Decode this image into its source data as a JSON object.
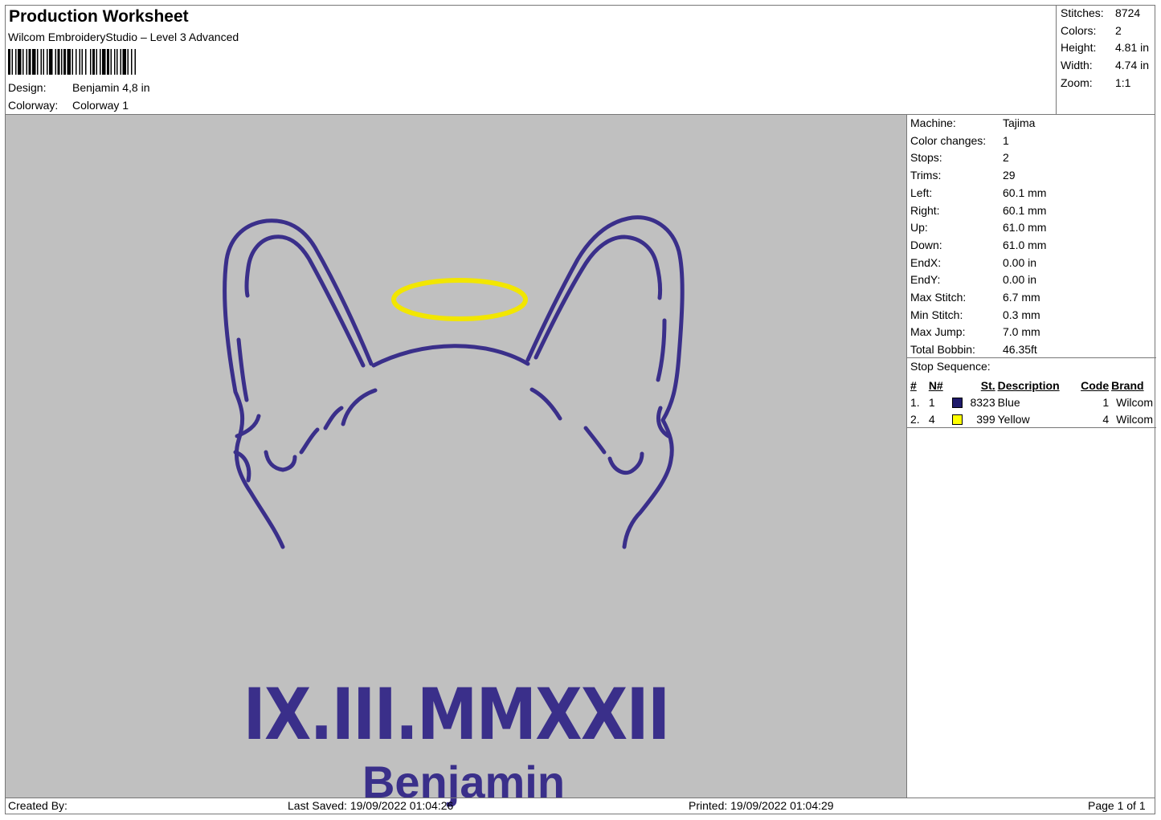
{
  "header": {
    "title": "Production Worksheet",
    "subtitle": "Wilcom EmbroideryStudio – Level 3 Advanced",
    "design_label": "Design:",
    "design_value": "Benjamin 4,8 in",
    "colorway_label": "Colorway:",
    "colorway_value": "Colorway 1"
  },
  "stats": [
    {
      "label": "Stitches:",
      "value": "8724"
    },
    {
      "label": "Colors:",
      "value": "2"
    },
    {
      "label": "Height:",
      "value": "4.81 in"
    },
    {
      "label": "Width:",
      "value": "4.74 in"
    },
    {
      "label": "Zoom:",
      "value": "1:1"
    }
  ],
  "machine_info": [
    {
      "label": "Machine:",
      "value": "Tajima"
    },
    {
      "label": "Color changes:",
      "value": "1"
    },
    {
      "label": "Stops:",
      "value": "2"
    },
    {
      "label": "Trims:",
      "value": "29"
    },
    {
      "label": "Left:",
      "value": "60.1 mm"
    },
    {
      "label": "Right:",
      "value": "60.1 mm"
    },
    {
      "label": "Up:",
      "value": "61.0 mm"
    },
    {
      "label": "Down:",
      "value": "61.0 mm"
    },
    {
      "label": "EndX:",
      "value": "0.00 in"
    },
    {
      "label": "EndY:",
      "value": "0.00 in"
    },
    {
      "label": "Max Stitch:",
      "value": "6.7 mm"
    },
    {
      "label": "Min Stitch:",
      "value": "0.3 mm"
    },
    {
      "label": "Max Jump:",
      "value": "7.0 mm"
    },
    {
      "label": "Total Bobbin:",
      "value": "46.35ft"
    }
  ],
  "stop_sequence": {
    "title": "Stop Sequence:",
    "columns": [
      "#",
      "N#",
      "St.",
      "Description",
      "Code",
      "Brand"
    ],
    "rows": [
      {
        "num": "1.",
        "n": "1",
        "color": "#1f1a6b",
        "st": "8323",
        "description": "Blue",
        "code": "1",
        "brand": "Wilcom"
      },
      {
        "num": "2.",
        "n": "4",
        "color": "#ffff00",
        "st": "399",
        "description": "Yellow",
        "code": "4",
        "brand": "Wilcom"
      }
    ]
  },
  "design": {
    "date_text": "IX.III.MMXXII",
    "name_text": "Benjamin",
    "thread_blue": "#3a2f8a",
    "thread_yellow": "#f2e600",
    "background": "#c0c0c0"
  },
  "footer": {
    "created_by": "Created By:",
    "last_saved": "Last Saved: 19/09/2022 01:04:26",
    "printed": "Printed: 19/09/2022 01:04:29",
    "page": "Page 1 of 1"
  }
}
